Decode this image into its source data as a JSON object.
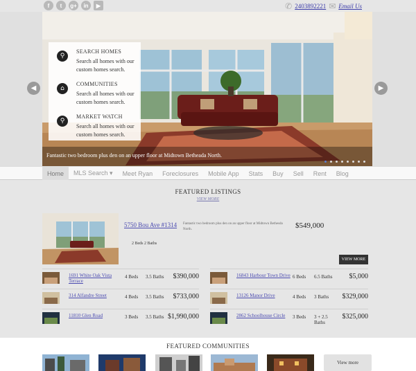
{
  "social": [
    {
      "icon": "facebook-icon",
      "glyph": "f"
    },
    {
      "icon": "twitter-icon",
      "glyph": "t"
    },
    {
      "icon": "google-plus-icon",
      "glyph": "g+"
    },
    {
      "icon": "linkedin-icon",
      "glyph": "in"
    },
    {
      "icon": "youtube-icon",
      "glyph": "▶"
    }
  ],
  "contact": {
    "phone": "2403892221",
    "email_label": "Email Us",
    "phone_icon": "phone-icon",
    "email_icon": "envelope-icon"
  },
  "hero": {
    "caption": "Fantastic two bedroom plus den on an upper floor at Midtown Betheada North.",
    "slide_count": 8,
    "active_slide": 1,
    "features": [
      {
        "icon": "search-icon",
        "title": "SEARCH HOMES",
        "desc": "Search all homes with our custom homes search."
      },
      {
        "icon": "home-icon",
        "title": "COMMUNITIES",
        "desc": "Search all homes with our custom homes search."
      },
      {
        "icon": "magnifier-icon",
        "title": "MARKET WATCH",
        "desc": "Search all homes with our custom homes search."
      }
    ]
  },
  "nav": [
    "Home",
    "MLS Search ▾",
    "Meet Ryan",
    "Foreclosures",
    "Mobile App",
    "Stats",
    "Buy",
    "Sell",
    "Rent",
    "Blog"
  ],
  "listings": {
    "title": "FEATURED LISTINGS",
    "view_more_link": "VIEW MORE",
    "featured": {
      "address": "5750 Bou Ave #1314",
      "desc": "Fantastic two bedroom plus den on an upper floor at Midtown Bethesda North.",
      "price": "$549,000",
      "beds_baths": "2 Beds 2 Baths",
      "button": "VIEW MORE"
    },
    "left": [
      {
        "address": "1691 White Oak Vista Terrace",
        "beds": "4 Beds",
        "baths": "3.5 Baths",
        "price": "$390,000"
      },
      {
        "address": "314 Alfandre Street",
        "beds": "4 Beds",
        "baths": "3.5 Baths",
        "price": "$733,000"
      },
      {
        "address": "11810 Glen Road",
        "beds": "3 Beds",
        "baths": "3.5 Baths",
        "price": "$1,990,000"
      }
    ],
    "right": [
      {
        "address": "16843 Harbour Town Drive",
        "beds": "6 Beds",
        "baths": "6.5 Baths",
        "price": "$5,000"
      },
      {
        "address": "13126 Manor Drive",
        "beds": "4 Beds",
        "baths": "3 Baths",
        "price": "$329,000"
      },
      {
        "address": "2862 Schoolhouse Circle",
        "beds": "3 Beds",
        "baths": "3 + 2.5 Baths",
        "price": "$325,000"
      }
    ]
  },
  "communities": {
    "title": "FEATURED COMMUNITIES",
    "view_more": "View more"
  }
}
